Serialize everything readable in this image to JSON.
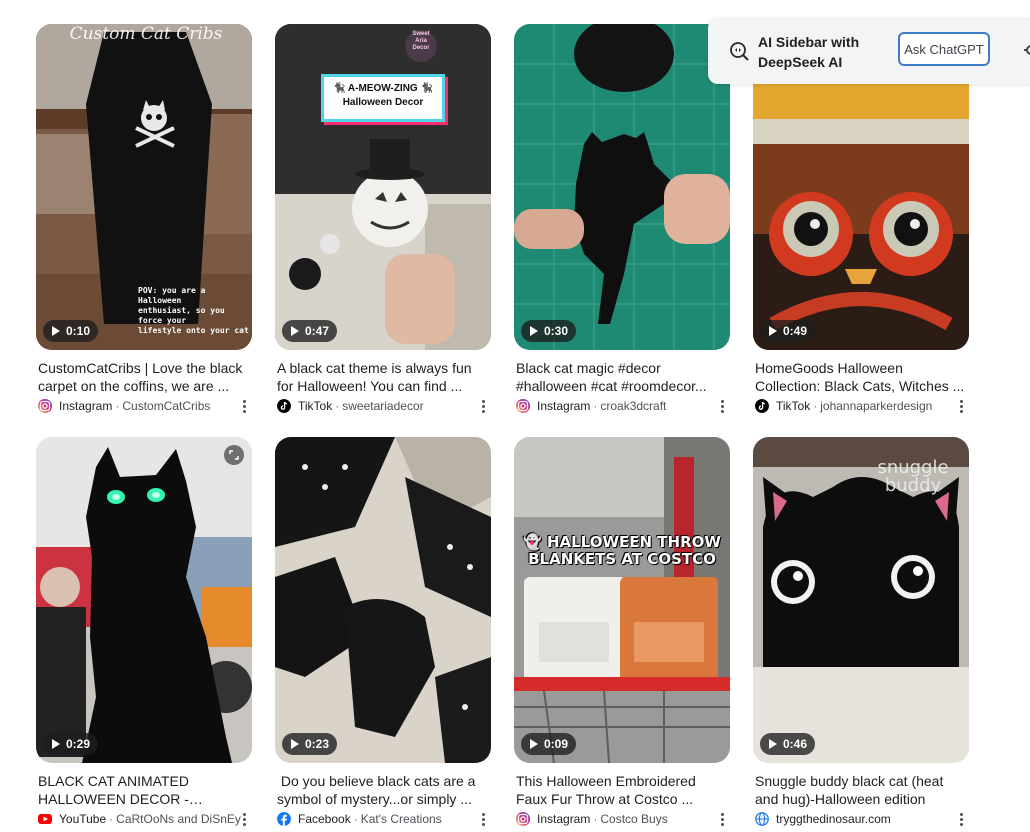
{
  "popup": {
    "title_line1": "AI Sidebar with",
    "title_line2": "DeepSeek AI",
    "button_label": "Ask ChatGPT"
  },
  "videos": [
    {
      "duration": "0:10",
      "title": "CustomCatCribs | Love the black carpet on the coffins, we are ...",
      "source": "Instagram",
      "author": "CustomCatCribs",
      "overlay_lines": [
        "Custom Cat Cribs",
        "POV: you are a Halloween",
        "enthusiast, so you force your",
        "lifestyle onto your cat"
      ]
    },
    {
      "duration": "0:47",
      "title": "A black cat theme is always fun for Halloween! You can find ...",
      "source": "TikTok",
      "author": "sweetariadecor",
      "overlay_lines": [
        "🐈‍⬛ A-MEOW-ZING 🐈‍⬛",
        "Halloween Decor",
        "Sweet",
        "Aria",
        "Decor"
      ]
    },
    {
      "duration": "0:30",
      "title": "Black cat magic #decor #halloween #cat #roomdecor...",
      "source": "Instagram",
      "author": "croak3dcraft",
      "overlay_lines": []
    },
    {
      "duration": "0:49",
      "title": "HomeGoods Halloween Collection: Black Cats, Witches ...",
      "source": "TikTok",
      "author": "johannaparkerdesign",
      "overlay_lines": []
    },
    {
      "duration": "0:29",
      "title": "BLACK CAT ANIMATED HALLOWEEN DECOR - FREAK...",
      "source": "YouTube",
      "author": "CaRtOoNs and DiSnEy",
      "overlay_lines": []
    },
    {
      "duration": "0:23",
      "title": " Do you believe black cats are a symbol of mystery...or simply ...",
      "source": "Facebook",
      "author": "Kat's Creations",
      "overlay_lines": []
    },
    {
      "duration": "0:09",
      "title": "This Halloween Embroidered Faux Fur Throw at Costco ...",
      "source": "Instagram",
      "author": "Costco Buys",
      "overlay_lines": [
        "👻 HALLOWEEN THROW",
        "BLANKETS AT COSTCO"
      ]
    },
    {
      "duration": "0:46",
      "title": "Snuggle buddy black cat (heat and hug)-Halloween edition",
      "source": "",
      "author": "tryggthedinosaur.com",
      "overlay_lines": [
        "snuggle",
        "buddy"
      ]
    }
  ],
  "colors": {
    "instagram": "#d6249f",
    "tiktok": "#000000",
    "youtube": "#ff0000",
    "facebook": "#1877f2",
    "web": "#1a73e8",
    "popup_button_border": "#3d7cc9"
  }
}
